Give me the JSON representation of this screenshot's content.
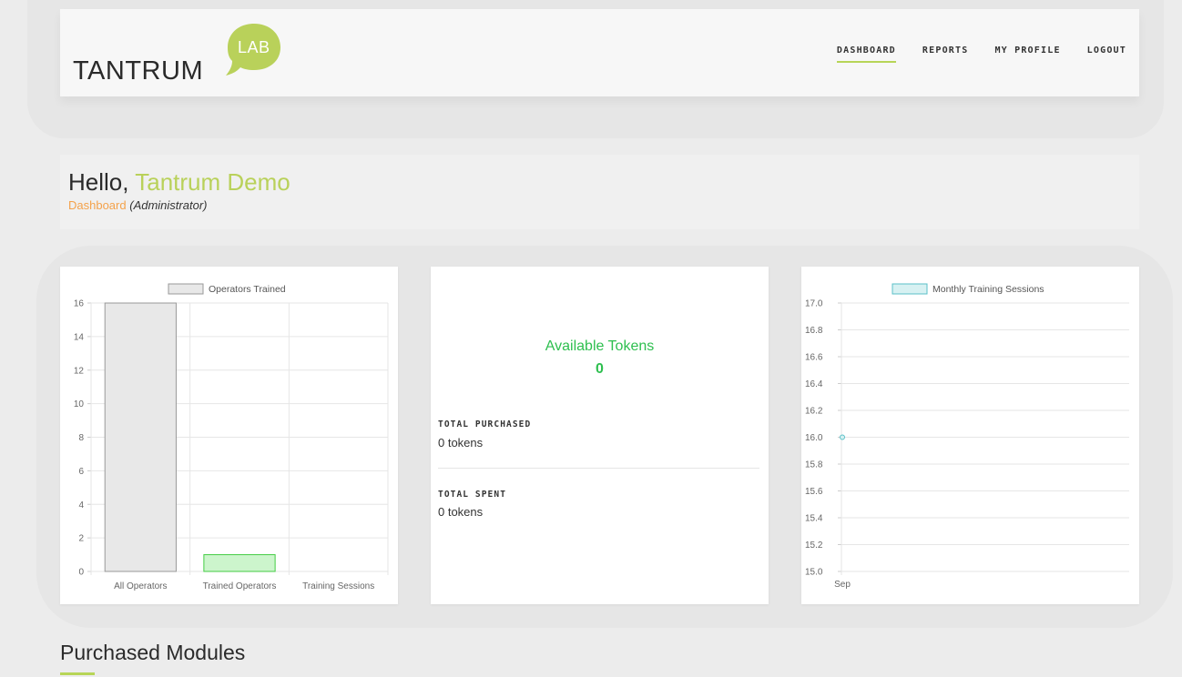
{
  "brand": {
    "name": "TANTRUM",
    "badge": "LAB",
    "accent": "#b9d15a"
  },
  "nav": {
    "items": [
      {
        "label": "DASHBOARD",
        "active": true
      },
      {
        "label": "REPORTS",
        "active": false
      },
      {
        "label": "MY PROFILE",
        "active": false
      },
      {
        "label": "LOGOUT",
        "active": false
      }
    ]
  },
  "greeting": {
    "hello": "Hello, ",
    "user_name": "Tantrum Demo",
    "page": "Dashboard",
    "role": "(Administrator)"
  },
  "tokens": {
    "title": "Available Tokens",
    "available": "0",
    "purchased_label": "TOTAL PURCHASED",
    "purchased_value": "0 tokens",
    "spent_label": "TOTAL SPENT",
    "spent_value": "0 tokens"
  },
  "chart_data": [
    {
      "type": "bar",
      "categories": [
        "All Operators",
        "Trained Operators",
        "Training Sessions"
      ],
      "series": [
        {
          "name": "Operators Trained",
          "values": [
            16,
            1,
            0
          ],
          "colors": [
            "#e8e8e8",
            "#ccf5cc",
            "#ccf5cc"
          ],
          "borders": [
            "#999999",
            "#44cc44",
            "#44cc44"
          ]
        }
      ],
      "ylim": [
        0,
        16
      ],
      "yticks": [
        "0",
        "2",
        "4",
        "6",
        "8",
        "10",
        "12",
        "14",
        "16"
      ],
      "legend": "top",
      "grid": true
    },
    {
      "type": "line",
      "x": [
        "Sep"
      ],
      "series": [
        {
          "name": "Monthly Training Sessions",
          "values": [
            16
          ],
          "color": "#5bc0c8",
          "fill": "#d7f1f2"
        }
      ],
      "ylim": [
        15,
        17
      ],
      "yticks": [
        "15.0",
        "15.2",
        "15.4",
        "15.6",
        "15.8",
        "16.0",
        "16.2",
        "16.4",
        "16.6",
        "16.8",
        "17.0"
      ],
      "legend": "top",
      "grid": true
    }
  ],
  "section": {
    "title": "Purchased Modules"
  }
}
